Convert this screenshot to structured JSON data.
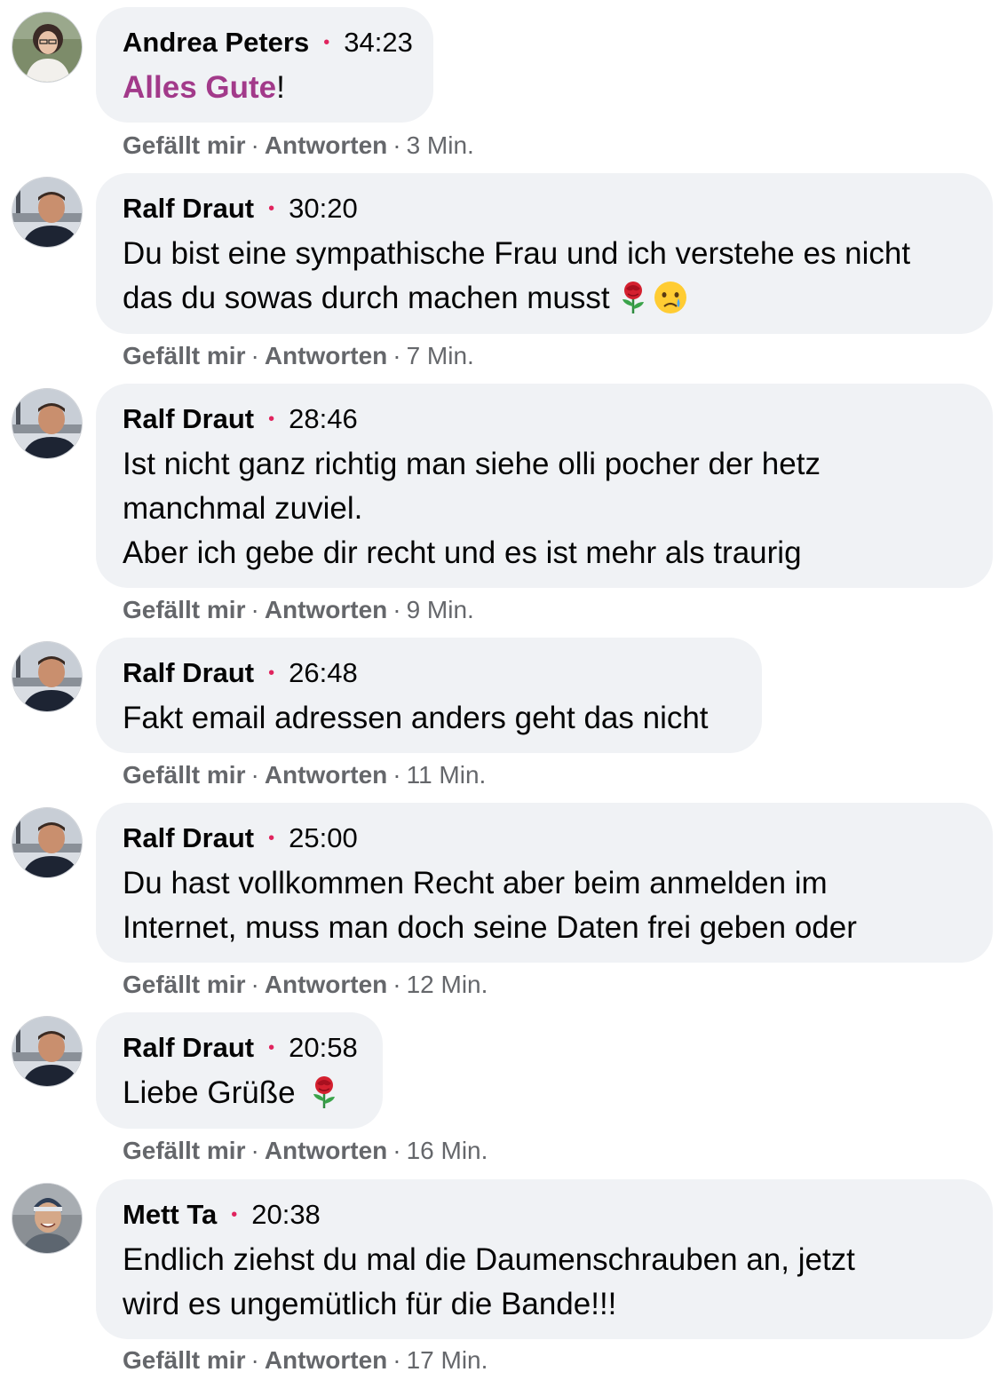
{
  "actions": {
    "like_label": "Gefällt mir",
    "reply_label": "Antworten",
    "separator": "·"
  },
  "comments": [
    {
      "author": "Andrea Peters",
      "timecode": "34:23",
      "text_highlight": "Alles Gute",
      "text_rest": "!",
      "age": "3 Min."
    },
    {
      "author": "Ralf Draut",
      "timecode": "30:20",
      "text": "Du bist eine sympathische Frau und ich verstehe es nicht\ndas du sowas durch machen musst",
      "emojis": [
        "rose-emoji",
        "crying-face-emoji"
      ],
      "age": "7 Min."
    },
    {
      "author": "Ralf Draut",
      "timecode": "28:46",
      "text": "Ist nicht ganz richtig man siehe olli pocher der hetz\nmanchmal zuviel.\nAber ich gebe dir recht und es ist mehr als traurig",
      "age": "9 Min."
    },
    {
      "author": "Ralf Draut",
      "timecode": "26:48",
      "text": "Fakt email adressen anders geht das nicht",
      "age": "11 Min."
    },
    {
      "author": "Ralf Draut",
      "timecode": "25:00",
      "text": "Du hast vollkommen Recht aber beim anmelden im\nInternet, muss man doch seine Daten frei geben oder",
      "age": "12 Min."
    },
    {
      "author": "Ralf Draut",
      "timecode": "20:58",
      "text": "Liebe Grüße",
      "emojis": [
        "rose-emoji"
      ],
      "age": "16 Min."
    },
    {
      "author": "Mett Ta",
      "timecode": "20:38",
      "text": "Endlich ziehst du mal die Daumenschrauben an, jetzt\nwird es ungemütlich für die Bande!!!",
      "age": "17 Min."
    }
  ],
  "colors": {
    "bubble_bg": "#f0f2f5",
    "highlight_text": "#a23a8a",
    "timecode_dot": "#e0245e",
    "action_text": "#65676b"
  }
}
